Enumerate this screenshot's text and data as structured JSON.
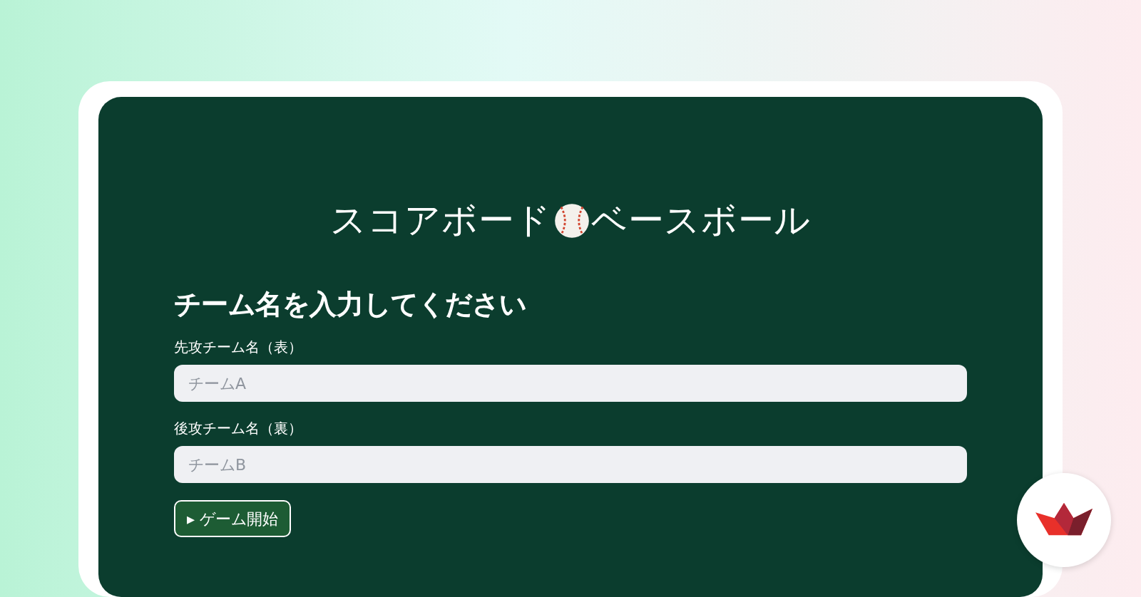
{
  "title": {
    "before": "スコアボード",
    "after": "ベースボール"
  },
  "heading": "チーム名を入力してください",
  "fields": [
    {
      "label": "先攻チーム名（表）",
      "placeholder": "チームA"
    },
    {
      "label": "後攻チーム名（裏）",
      "placeholder": "チームB"
    }
  ],
  "start_button": {
    "icon": "▸",
    "label": "ゲーム開始"
  }
}
